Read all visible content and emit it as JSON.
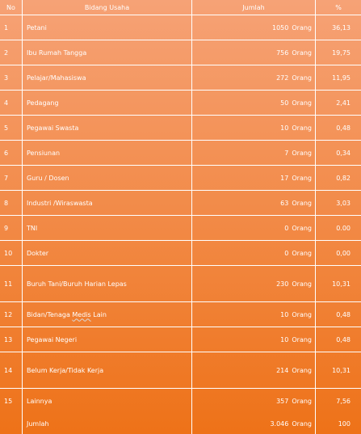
{
  "header": {
    "no": "No",
    "bidang": "Bidang Usaha",
    "jumlah": "Jumlah",
    "pct": "%"
  },
  "rows": [
    {
      "no": "1",
      "bidang": "Petani",
      "jumlah": "1050",
      "unit": "Orang",
      "pct": "36,13"
    },
    {
      "no": "2",
      "bidang": "Ibu Rumah Tangga",
      "jumlah": "756",
      "unit": "Orang",
      "pct": "19,75"
    },
    {
      "no": "3",
      "bidang": "Pelajar/Mahasiswa",
      "jumlah": "272",
      "unit": "Orang",
      "pct": "11,95"
    },
    {
      "no": "4",
      "bidang": "Pedagang",
      "jumlah": "50",
      "unit": "Orang",
      "pct": "2,41"
    },
    {
      "no": "5",
      "bidang": "Pegawai Swasta",
      "jumlah": "10",
      "unit": "Orang",
      "pct": "0,48"
    },
    {
      "no": "6",
      "bidang": "Pensiunan",
      "jumlah": "7",
      "unit": "Orang",
      "pct": "0,34"
    },
    {
      "no": "7",
      "bidang": "Guru / Dosen",
      "jumlah": "17",
      "unit": "Orang",
      "pct": "0,82"
    },
    {
      "no": "8",
      "bidang": "Industri /Wiraswasta",
      "jumlah": "63",
      "unit": "Orang",
      "pct": "3,03"
    },
    {
      "no": "9",
      "bidang": "TNI",
      "jumlah": "0",
      "unit": "Orang",
      "pct": "0.00"
    },
    {
      "no": "10",
      "bidang": "Dokter",
      "jumlah": "0",
      "unit": "Orang",
      "pct": "0,00"
    },
    {
      "no": "11",
      "bidang": "Buruh Tani/Buruh Harian Lepas",
      "jumlah": "230",
      "unit": "Orang",
      "pct": "10,31"
    },
    {
      "no": "12",
      "bidang": "Bidan/Tenaga Medis Lain",
      "jumlah": "10",
      "unit": "Orang",
      "pct": "0,48"
    },
    {
      "no": "13",
      "bidang": "Pegawai Negeri",
      "jumlah": "10",
      "unit": "Orang",
      "pct": "0,48"
    },
    {
      "no": "14",
      "bidang": "Belum Kerja/Tidak Kerja",
      "jumlah": "214",
      "unit": "Orang",
      "pct": "10,31"
    },
    {
      "no": "15",
      "bidang": "Lainnya",
      "jumlah": "357",
      "unit": "Orang",
      "pct": "7,56"
    }
  ],
  "total": {
    "no": "",
    "bidang": "Jumlah",
    "jumlah": "3.046",
    "unit": "Orang",
    "pct": "100"
  },
  "colors": {
    "gradient_top": "#f6a276",
    "gradient_bottom": "#ee7218",
    "text": "#ffffff",
    "border": "#ffffff"
  }
}
